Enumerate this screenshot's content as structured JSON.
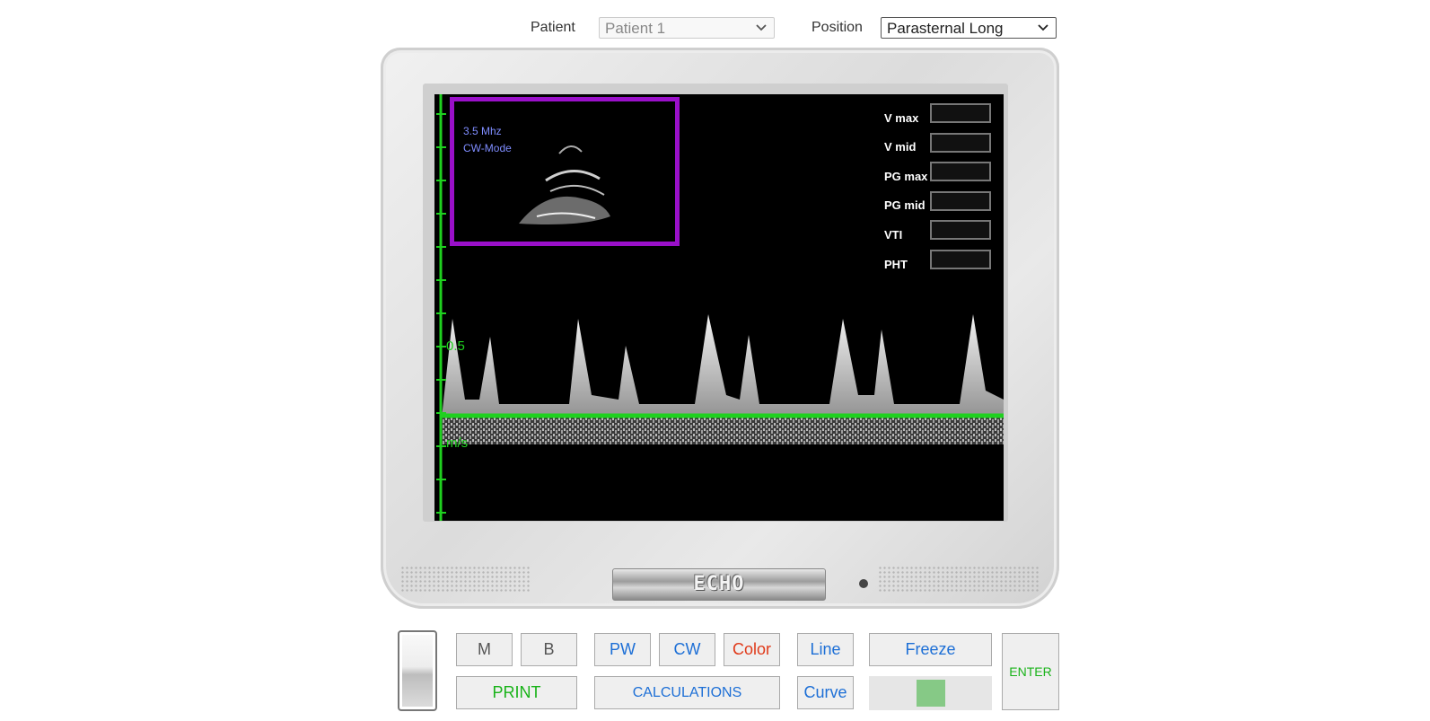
{
  "header": {
    "patient_label": "Patient",
    "patient_value": "Patient 1",
    "position_label": "Position",
    "position_value": "Parasternal Long"
  },
  "monitor": {
    "brand": "ECHO"
  },
  "screen": {
    "frequency": "3.5 Mhz",
    "mode": "CW-Mode",
    "scale_value": "0.5",
    "unit": "m/s",
    "measurements": [
      {
        "label": "V max",
        "value": ""
      },
      {
        "label": "V mid",
        "value": ""
      },
      {
        "label": "PG max",
        "value": ""
      },
      {
        "label": "PG mid",
        "value": ""
      },
      {
        "label": "VTI",
        "value": ""
      },
      {
        "label": "PHT",
        "value": ""
      }
    ]
  },
  "controls": {
    "m": "M",
    "b": "B",
    "pw": "PW",
    "cw": "CW",
    "color": "Color",
    "line": "Line",
    "freeze": "Freeze",
    "enter": "ENTER",
    "print": "PRINT",
    "calculations": "CALCULATIONS",
    "curve": "Curve",
    "slider_level": 0.5
  },
  "colors": {
    "axis": "#1fd11f",
    "frame": "#9a10c9",
    "label": "#7f8dff"
  }
}
